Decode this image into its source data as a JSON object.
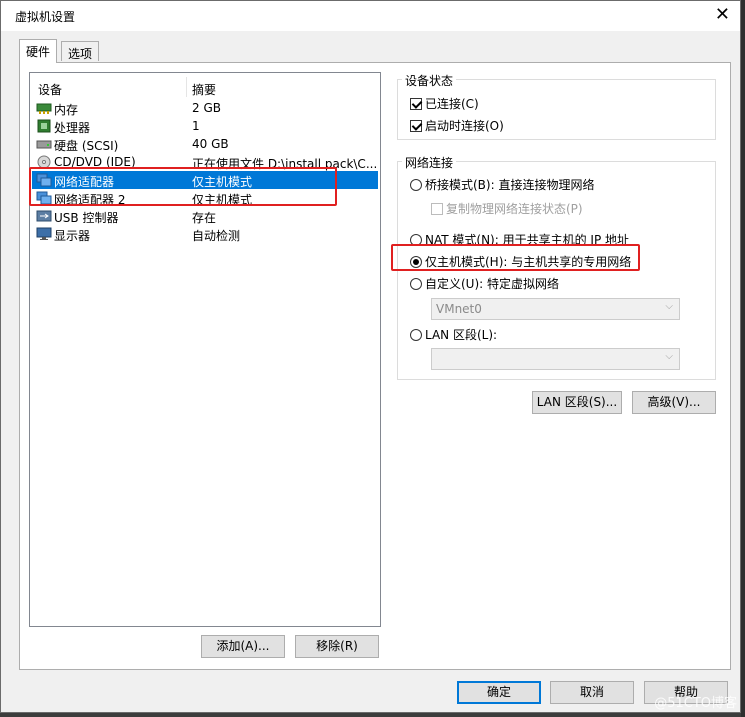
{
  "window": {
    "title": "虚拟机设置",
    "close_glyph": "✕"
  },
  "tabs": [
    {
      "label": "硬件"
    },
    {
      "label": "选项"
    }
  ],
  "device_list": {
    "headers": {
      "device": "设备",
      "summary": "摘要"
    },
    "rows": [
      {
        "name": "内存",
        "summary": "2 GB",
        "icon": "memory-icon"
      },
      {
        "name": "处理器",
        "summary": "1",
        "icon": "cpu-icon"
      },
      {
        "name": "硬盘 (SCSI)",
        "summary": "40 GB",
        "icon": "harddisk-icon"
      },
      {
        "name": "CD/DVD (IDE)",
        "summary": "正在使用文件 D:\\install pack\\C...",
        "icon": "cdrom-icon"
      },
      {
        "name": "网络适配器",
        "summary": "仅主机模式",
        "icon": "network-adapter-icon",
        "selected": true
      },
      {
        "name": "网络适配器 2",
        "summary": "仅主机模式",
        "icon": "network-adapter-icon"
      },
      {
        "name": "USB 控制器",
        "summary": "存在",
        "icon": "usb-icon"
      },
      {
        "name": "显示器",
        "summary": "自动检测",
        "icon": "monitor-icon"
      }
    ],
    "add_label": "添加(A)...",
    "remove_label": "移除(R)"
  },
  "device_status": {
    "title": "设备状态",
    "connected": "已连接(C)",
    "connect_at_power_on": "启动时连接(O)"
  },
  "network": {
    "title": "网络连接",
    "bridged": "桥接模式(B): 直接连接物理网络",
    "replicate": "复制物理网络连接状态(P)",
    "nat": "NAT 模式(N): 用于共享主机的 IP 地址",
    "host_only": "仅主机模式(H): 与主机共享的专用网络",
    "custom": "自定义(U): 特定虚拟网络",
    "custom_value": "VMnet0",
    "lan_segment": "LAN 区段(L):",
    "lan_segment_value": "",
    "lan_segments_button": "LAN 区段(S)...",
    "advanced_button": "高级(V)..."
  },
  "footer": {
    "ok": "确定",
    "cancel": "取消",
    "help": "帮助"
  },
  "watermark": "@51CTO博客",
  "colors": {
    "selection": "#0078d7",
    "highlight_box": "#e02020"
  }
}
